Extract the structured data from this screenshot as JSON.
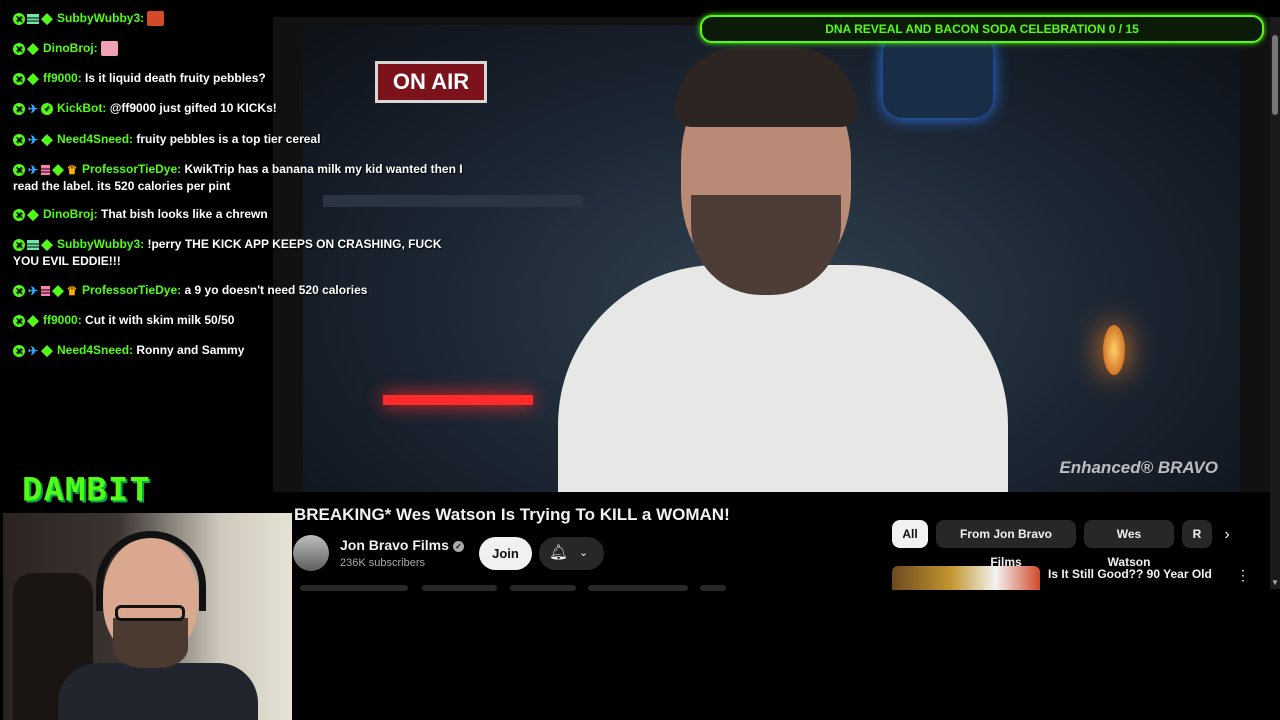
{
  "chat": {
    "messages": [
      {
        "user": "SubbyWubby3:",
        "text": "",
        "badges": [
          "mod",
          "vip",
          "sub"
        ],
        "emote": "cat-emote"
      },
      {
        "user": "DinoBroj:",
        "text": "",
        "badges": [
          "mod",
          "sub"
        ],
        "emote": "pig-emote"
      },
      {
        "user": "ff9000:",
        "text": "Is it liquid death fruity pebbles?",
        "badges": [
          "mod",
          "sub"
        ]
      },
      {
        "user": "KickBot:",
        "text": "@ff9000 just gifted 10 KICKs!",
        "badges": [
          "mod",
          "og",
          "verified"
        ]
      },
      {
        "user": "Need4Sneed:",
        "text": "fruity pebbles is a top tier cereal",
        "badges": [
          "mod",
          "og",
          "sub"
        ]
      },
      {
        "user": "ProfessorTieDye:",
        "text": "KwikTrip has a banana milk my kid wanted then I read the label. its 520 calories per pint",
        "badges": [
          "mod",
          "og",
          "pink",
          "sub",
          "crown"
        ]
      },
      {
        "user": "DinoBroj:",
        "text": "That bish looks like a chrewn",
        "badges": [
          "mod",
          "sub"
        ]
      },
      {
        "user": "SubbyWubby3:",
        "text": "!perry THE KICK APP KEEPS ON CRASHING, FUCK YOU EVIL EDDIE!!!",
        "badges": [
          "mod",
          "vip",
          "sub"
        ]
      },
      {
        "user": "ProfessorTieDye:",
        "text": "a 9 yo doesn't need 520 calories",
        "badges": [
          "mod",
          "og",
          "pink",
          "sub",
          "crown"
        ]
      },
      {
        "user": "ff9000:",
        "text": "Cut it with skim milk 50/50",
        "badges": [
          "mod",
          "sub"
        ]
      },
      {
        "user": "Need4Sneed:",
        "text": "Ronny and Sammy",
        "badges": [
          "mod",
          "og",
          "sub"
        ]
      }
    ]
  },
  "overlay": {
    "logo_text": "DAMBIT",
    "goal_text": "DNA REVEAL AND BACON SODA CELEBRATION 0 / 15",
    "goal_progress": 0
  },
  "video": {
    "sign_text": "ON AIR",
    "watermark": "Enhanced® BRAVO",
    "title": "BREAKING* Wes Watson Is Trying To KILL a WOMAN!",
    "channel": "Jon Bravo Films",
    "subscribers": "236K subscribers",
    "join_label": "Join"
  },
  "filters": {
    "chips": [
      "All",
      "From Jon Bravo Films",
      "Wes Watson",
      "R"
    ]
  },
  "recommended": [
    {
      "title": "Is It Still Good?? 90 Year Old"
    }
  ],
  "colors": {
    "kick_green": "#53fc18",
    "yt_dark": "#0f0f0f",
    "chip_bg": "#272727"
  }
}
